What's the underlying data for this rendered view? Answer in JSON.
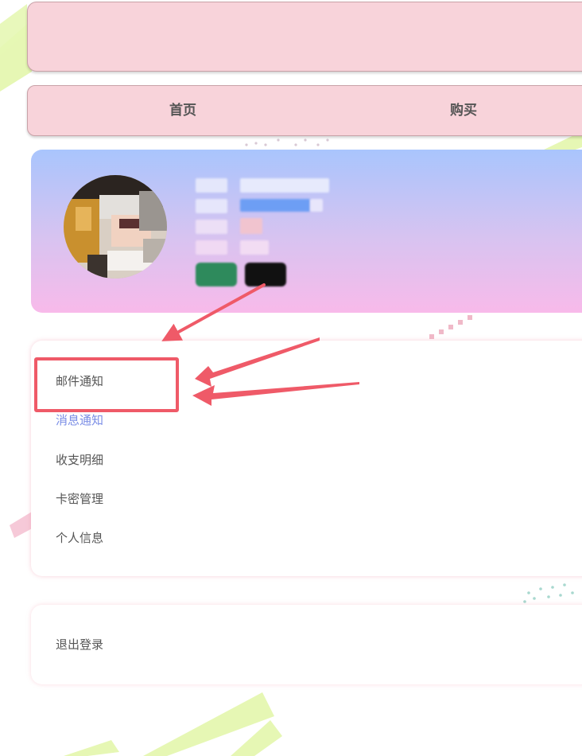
{
  "nav": {
    "items": [
      {
        "label": "首页"
      },
      {
        "label": "购买"
      }
    ]
  },
  "menu": {
    "items": [
      {
        "label": "邮件通知",
        "active": false
      },
      {
        "label": "消息通知",
        "active": true
      },
      {
        "label": "收支明细",
        "active": false
      },
      {
        "label": "卡密管理",
        "active": false
      },
      {
        "label": "个人信息",
        "active": false
      }
    ]
  },
  "logout": {
    "label": "退出登录"
  },
  "colors": {
    "header_bg": "#f8d3da",
    "accent_active": "#7a8de6",
    "annotation_red": "#ef5a68",
    "badge_green": "#2e8a5c",
    "badge_black": "#111111"
  }
}
